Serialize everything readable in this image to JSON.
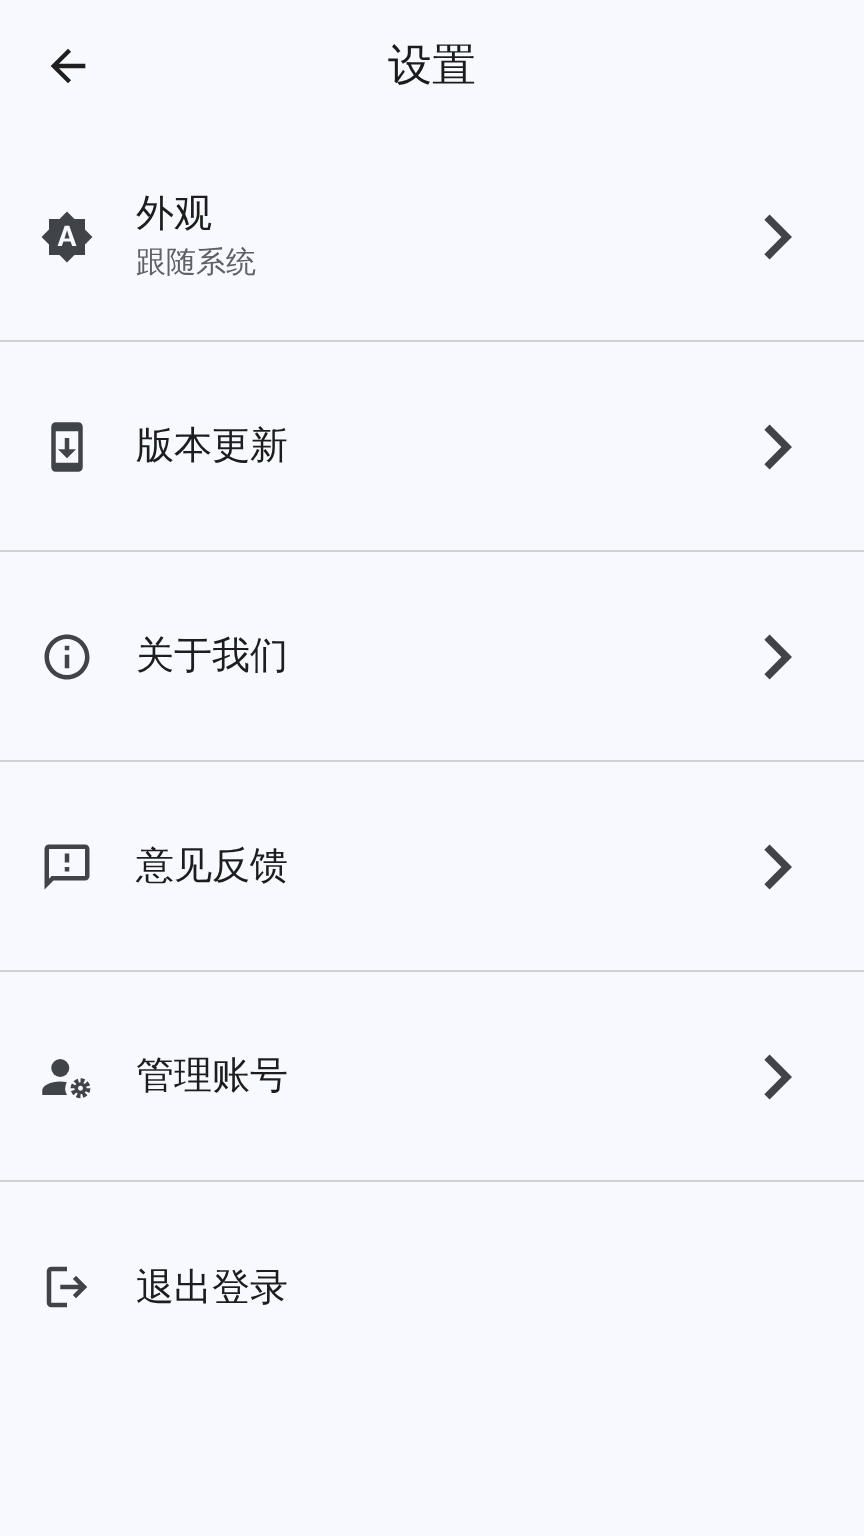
{
  "header": {
    "title": "设置"
  },
  "settings": [
    {
      "kind": "auto-brightness",
      "label": "外观",
      "subtitle": "跟随系统",
      "chevron": true
    },
    {
      "kind": "phone-download",
      "label": "版本更新",
      "chevron": true
    },
    {
      "kind": "info",
      "label": "关于我们",
      "chevron": true
    },
    {
      "kind": "feedback",
      "label": "意见反馈",
      "chevron": true
    },
    {
      "kind": "account-gear",
      "label": "管理账号",
      "chevron": true
    },
    {
      "kind": "logout",
      "label": "退出登录",
      "chevron": false
    }
  ]
}
